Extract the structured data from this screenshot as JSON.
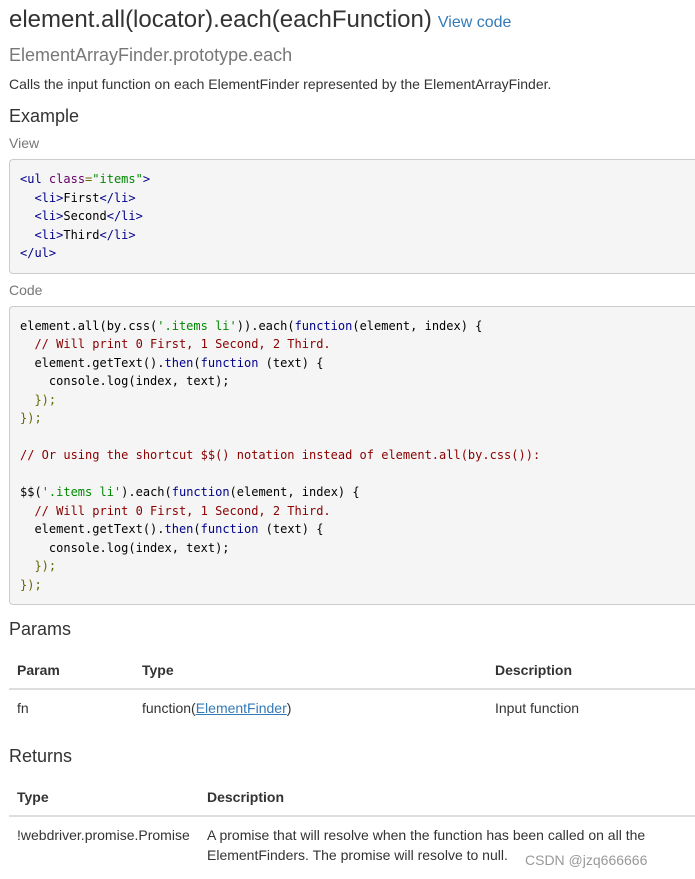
{
  "header": {
    "title": "element.all(locator).each(eachFunction)",
    "view_code_label": "View code",
    "subtitle": "ElementArrayFinder.prototype.each",
    "description": "Calls the input function on each ElementFinder represented by the ElementArrayFinder."
  },
  "example": {
    "heading": "Example",
    "view_label": "View",
    "view_code": {
      "ul_open": "<ul",
      "class_attr": "class",
      "class_value": "\"items\"",
      "gt": ">",
      "items": [
        "First",
        "Second",
        "Third"
      ],
      "li_open": "<li>",
      "li_close": "</li>",
      "ul_close": "</ul>"
    },
    "code_label": "Code",
    "code": {
      "l1_a": "element.all(by.css(",
      "l1_str": "'.items li'",
      "l1_b": ")).each(",
      "l1_kw": "function",
      "l1_c": "(element, index) {",
      "comment1": "  // Will print 0 First, 1 Second, 2 Third.",
      "l3_a": "  element.getText().",
      "l3_then": "then",
      "l3_b": "(",
      "l3_kw": "function",
      "l3_c": " (text) {",
      "l4": "    console.log(index, text);",
      "l5": "  });",
      "l6": "});",
      "comment2": "// Or using the shortcut $$() notation instead of element.all(by.css()):",
      "l8_a": "$$(",
      "l8_str": "'.items li'",
      "l8_b": ").each(",
      "l8_kw": "function",
      "l8_c": "(element, index) {",
      "comment3": "  // Will print 0 First, 1 Second, 2 Third.",
      "l10_a": "  element.getText().",
      "l10_then": "then",
      "l10_b": "(",
      "l10_kw": "function",
      "l10_c": " (text) {",
      "l11": "    console.log(index, text);",
      "l12": "  });",
      "l13": "});"
    }
  },
  "params": {
    "heading": "Params",
    "columns": [
      "Param",
      "Type",
      "Description"
    ],
    "rows": [
      {
        "param": "fn",
        "type_prefix": "function(",
        "type_link": "ElementFinder",
        "type_suffix": ")",
        "description": "Input function"
      }
    ]
  },
  "returns": {
    "heading": "Returns",
    "columns": [
      "Type",
      "Description"
    ],
    "rows": [
      {
        "type": "!webdriver.promise.Promise",
        "description_1": "A promise that will resolve when the function has been called on all the",
        "description_2": "ElementFinders. The promise will resolve to null."
      }
    ]
  },
  "watermark": "CSDN @jzq666666"
}
